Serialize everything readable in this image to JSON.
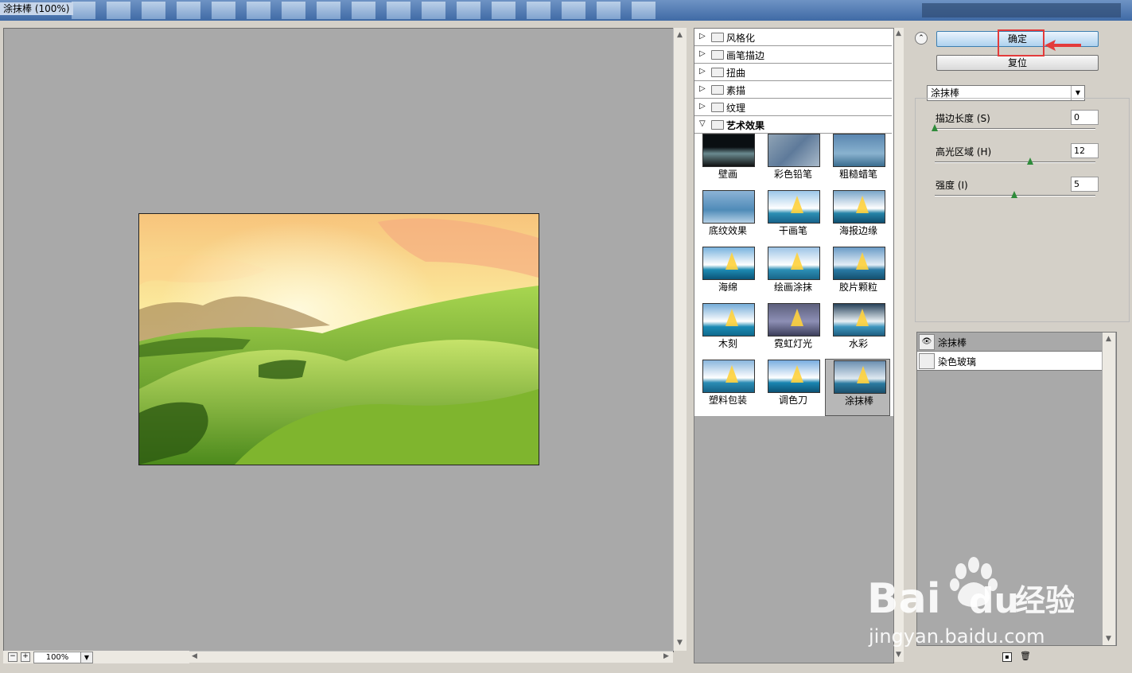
{
  "window": {
    "title": "涂抹棒 (100%)"
  },
  "preview": {
    "zoom": "100%"
  },
  "gallery": {
    "categories": [
      {
        "label": "风格化",
        "open": false
      },
      {
        "label": "画笔描边",
        "open": false
      },
      {
        "label": "扭曲",
        "open": false
      },
      {
        "label": "素描",
        "open": false
      },
      {
        "label": "纹理",
        "open": false
      },
      {
        "label": "艺术效果",
        "open": true
      }
    ],
    "filters": [
      "壁画",
      "彩色铅笔",
      "粗糙蜡笔",
      "底纹效果",
      "干画笔",
      "海报边缘",
      "海绵",
      "绘画涂抹",
      "胶片颗粒",
      "木刻",
      "霓虹灯光",
      "水彩",
      "塑料包装",
      "调色刀",
      "涂抹棒"
    ],
    "selected_filter": "涂抹棒"
  },
  "controls": {
    "ok_label": "确定",
    "reset_label": "复位",
    "filter_select_value": "涂抹棒",
    "params": [
      {
        "label": "描边长度 (S)",
        "value": "0",
        "level": 0.0
      },
      {
        "label": "高光区域 (H)",
        "value": "12",
        "level": 0.6
      },
      {
        "label": "强度 (I)",
        "value": "5",
        "level": 0.5
      }
    ]
  },
  "layers": [
    {
      "name": "涂抹棒",
      "visible": true
    },
    {
      "name": "染色玻璃",
      "visible": false
    }
  ],
  "watermark": {
    "text": "Bai du 经验",
    "url": "jingyan.baidu.com"
  },
  "colors": {
    "highlight": "#e33b3b",
    "ok_button": "#aed1ee",
    "slider_knob": "#2e8b3a"
  }
}
